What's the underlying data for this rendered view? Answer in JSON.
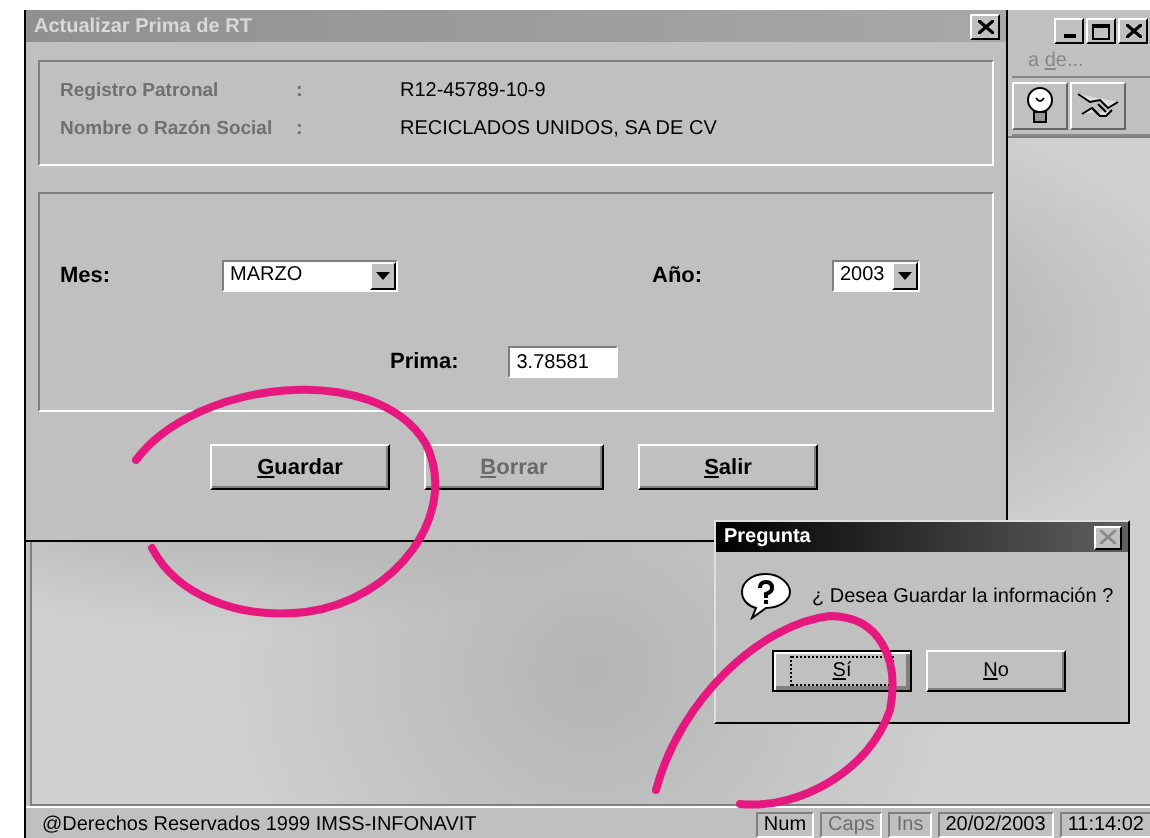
{
  "background_window": {
    "menu_item": {
      "label": "a de..."
    },
    "status_bar": {
      "copyright": "@Derechos Reservados 1999  IMSS-INFONAVIT",
      "indicators": [
        {
          "label": "Num",
          "disabled": false
        },
        {
          "label": "Caps",
          "disabled": true
        },
        {
          "label": "Ins",
          "disabled": true
        }
      ],
      "date": "20/02/2003",
      "time": "11:14:02"
    }
  },
  "dialog": {
    "title": "Actualizar Prima de RT",
    "info": [
      {
        "label": "Registro Patronal",
        "separator": ":",
        "value": "R12-45789-10-9"
      },
      {
        "label": "Nombre o Razón Social",
        "separator": ":",
        "value": "RECICLADOS UNIDOS, SA DE CV"
      }
    ],
    "mes": {
      "label": "Mes:",
      "value": "MARZO"
    },
    "anio": {
      "label": "Año:",
      "value": "2003"
    },
    "prima": {
      "label": "Prima:",
      "value": "3.78581"
    },
    "buttons": [
      {
        "label": "Guardar",
        "disabled": false
      },
      {
        "label": "Borrar",
        "disabled": true
      },
      {
        "label": "Salir",
        "disabled": false
      }
    ]
  },
  "message_box": {
    "title": "Pregunta",
    "message": "¿ Desea Guardar la información ?",
    "buttons": [
      {
        "label": "Sí",
        "focused": true
      },
      {
        "label": "No",
        "focused": false
      }
    ]
  }
}
